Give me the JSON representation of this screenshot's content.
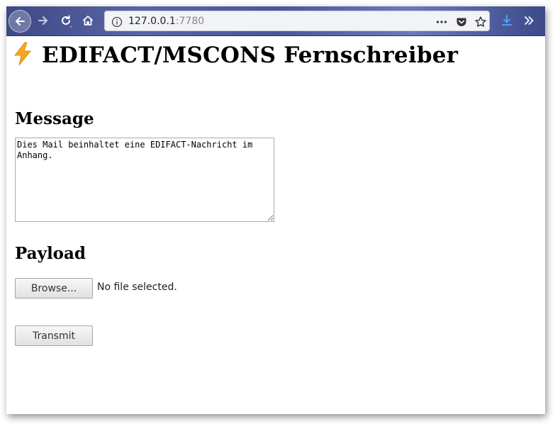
{
  "browser": {
    "url_host": "127.0.0.1",
    "url_port": ":7780",
    "icons": [
      "back-icon",
      "forward-icon",
      "reload-icon",
      "home-icon",
      "info-icon",
      "more-icon",
      "pocket-icon",
      "bookmark-star-icon",
      "download-icon",
      "overflow-icon"
    ]
  },
  "page": {
    "title": "EDIFACT/MSCONS Fernschreiber",
    "title_icon": "lightning-icon",
    "message_heading": "Message",
    "message_text": "Dies Mail beinhaltet eine EDIFACT-Nachricht im\nAnhang.",
    "payload_heading": "Payload",
    "browse_label": "Browse...",
    "file_status": "No file selected.",
    "transmit_label": "Transmit"
  },
  "colors": {
    "bolt": "#f5a623",
    "toolbar": "#4a5798"
  }
}
